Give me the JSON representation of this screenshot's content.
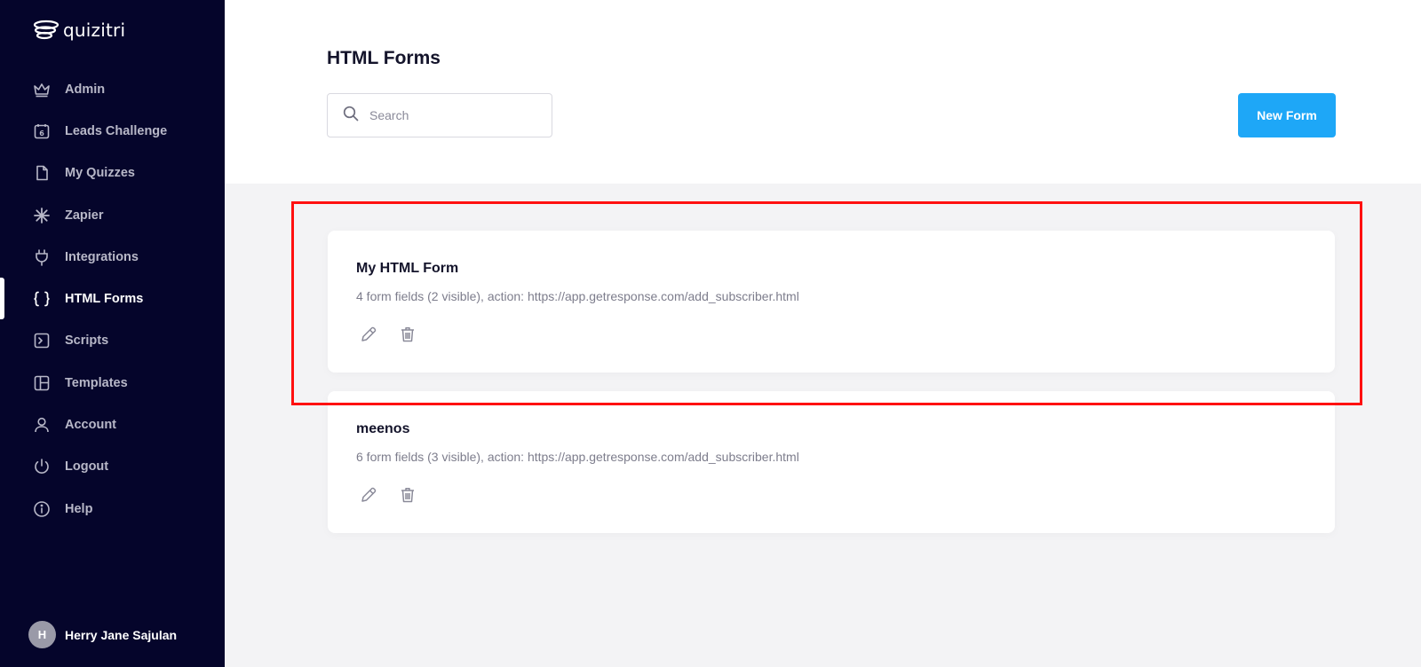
{
  "app": {
    "logo_text": "quizitri"
  },
  "sidebar": {
    "items": [
      {
        "label": "Admin",
        "icon": "crown-icon"
      },
      {
        "label": "Leads Challenge",
        "icon": "calendar-icon",
        "badge": "6"
      },
      {
        "label": "My Quizzes",
        "icon": "document-icon"
      },
      {
        "label": "Zapier",
        "icon": "asterisk-icon"
      },
      {
        "label": "Integrations",
        "icon": "plug-icon"
      },
      {
        "label": "HTML Forms",
        "icon": "braces-icon",
        "active": true
      },
      {
        "label": "Scripts",
        "icon": "terminal-icon"
      },
      {
        "label": "Templates",
        "icon": "layout-icon"
      },
      {
        "label": "Account",
        "icon": "user-icon"
      },
      {
        "label": "Logout",
        "icon": "power-icon"
      },
      {
        "label": "Help",
        "icon": "info-icon"
      }
    ],
    "user": {
      "initial": "H",
      "name": "Herry Jane Sajulan"
    }
  },
  "main": {
    "title": "HTML Forms",
    "search_placeholder": "Search",
    "new_button": "New Form",
    "forms": [
      {
        "name": "My HTML Form",
        "description": "4 form fields (2 visible), action: https://app.getresponse.com/add_subscriber.html"
      },
      {
        "name": "meenos",
        "description": "6 form fields (3 visible), action: https://app.getresponse.com/add_subscriber.html"
      }
    ]
  },
  "colors": {
    "sidebar_bg": "#05052b",
    "accent": "#1ea7f7",
    "highlight": "#ff1010"
  }
}
